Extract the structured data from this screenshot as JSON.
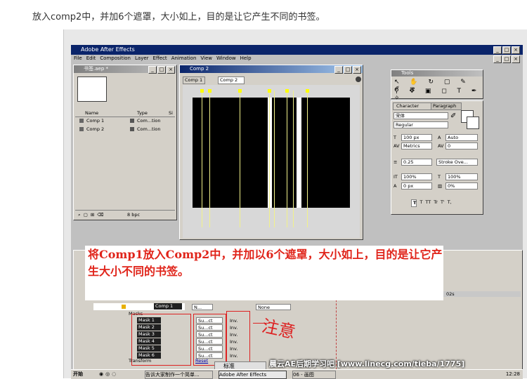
{
  "caption": "放入comp2中，并加6个遮罩，大小如上，目的是让它产生不同的书签。",
  "app": {
    "title": "Adobe After Effects",
    "menu": [
      "File",
      "Edit",
      "Composition",
      "Layer",
      "Effect",
      "Animation",
      "View",
      "Window",
      "Help"
    ]
  },
  "project": {
    "title": "书签.aep *",
    "columns": [
      "Name",
      "Type",
      "Si"
    ],
    "items": [
      {
        "name": "Comp 1",
        "type": "Com...tion"
      },
      {
        "name": "Comp 2",
        "type": "Com...tion"
      }
    ],
    "bpc": "8 bpc"
  },
  "comp": {
    "title": "Comp 2",
    "tabs": [
      "Comp 1",
      "Comp 2"
    ]
  },
  "tools": {
    "title": "Tools"
  },
  "character": {
    "tabs": [
      "Character",
      "Paragraph"
    ],
    "font": "宋体",
    "style": "Regular",
    "size": "100 px",
    "leading": "Auto",
    "kerning": "Metrics",
    "tracking": "0",
    "stroke_width": "0.25",
    "stroke_mode": "Stroke Ove...",
    "vscale": "100%",
    "hscale": "100%",
    "baseline": "0 px",
    "tsume": "0%",
    "style_buttons": [
      "T",
      "T",
      "TT",
      "Tr",
      "T'",
      "T,"
    ]
  },
  "annotation": "将Comp1放入Comp2中，并加以6个遮罩，大小如上，目的是让它产生大小不同的书签。",
  "timeline": {
    "layer_name": "Comp 1",
    "time_label": "02s",
    "masks_label": "Masks",
    "masks": [
      "Mask 1",
      "Mask 2",
      "Mask 3",
      "Mask 4",
      "Mask 5",
      "Mask 6"
    ],
    "mode": "Su...ct",
    "inv": "Inv.",
    "parent": "None",
    "transform": "Transform",
    "reset": "Reset",
    "handwriting": "注意",
    "switch_label": "标准"
  },
  "watermark": "晨云AE后期学习吧 [www.linecg.com/tieba/1775]",
  "taskbar": {
    "start": "开始",
    "items": [
      "告诉大家制作一个简单...",
      "Adobe After Effects",
      "06 - 画图"
    ],
    "clock": "12:28"
  },
  "colors": {
    "titlebar": "#0a246a",
    "annotation": "#e0241a",
    "mask_lines": "#f2f28a"
  }
}
